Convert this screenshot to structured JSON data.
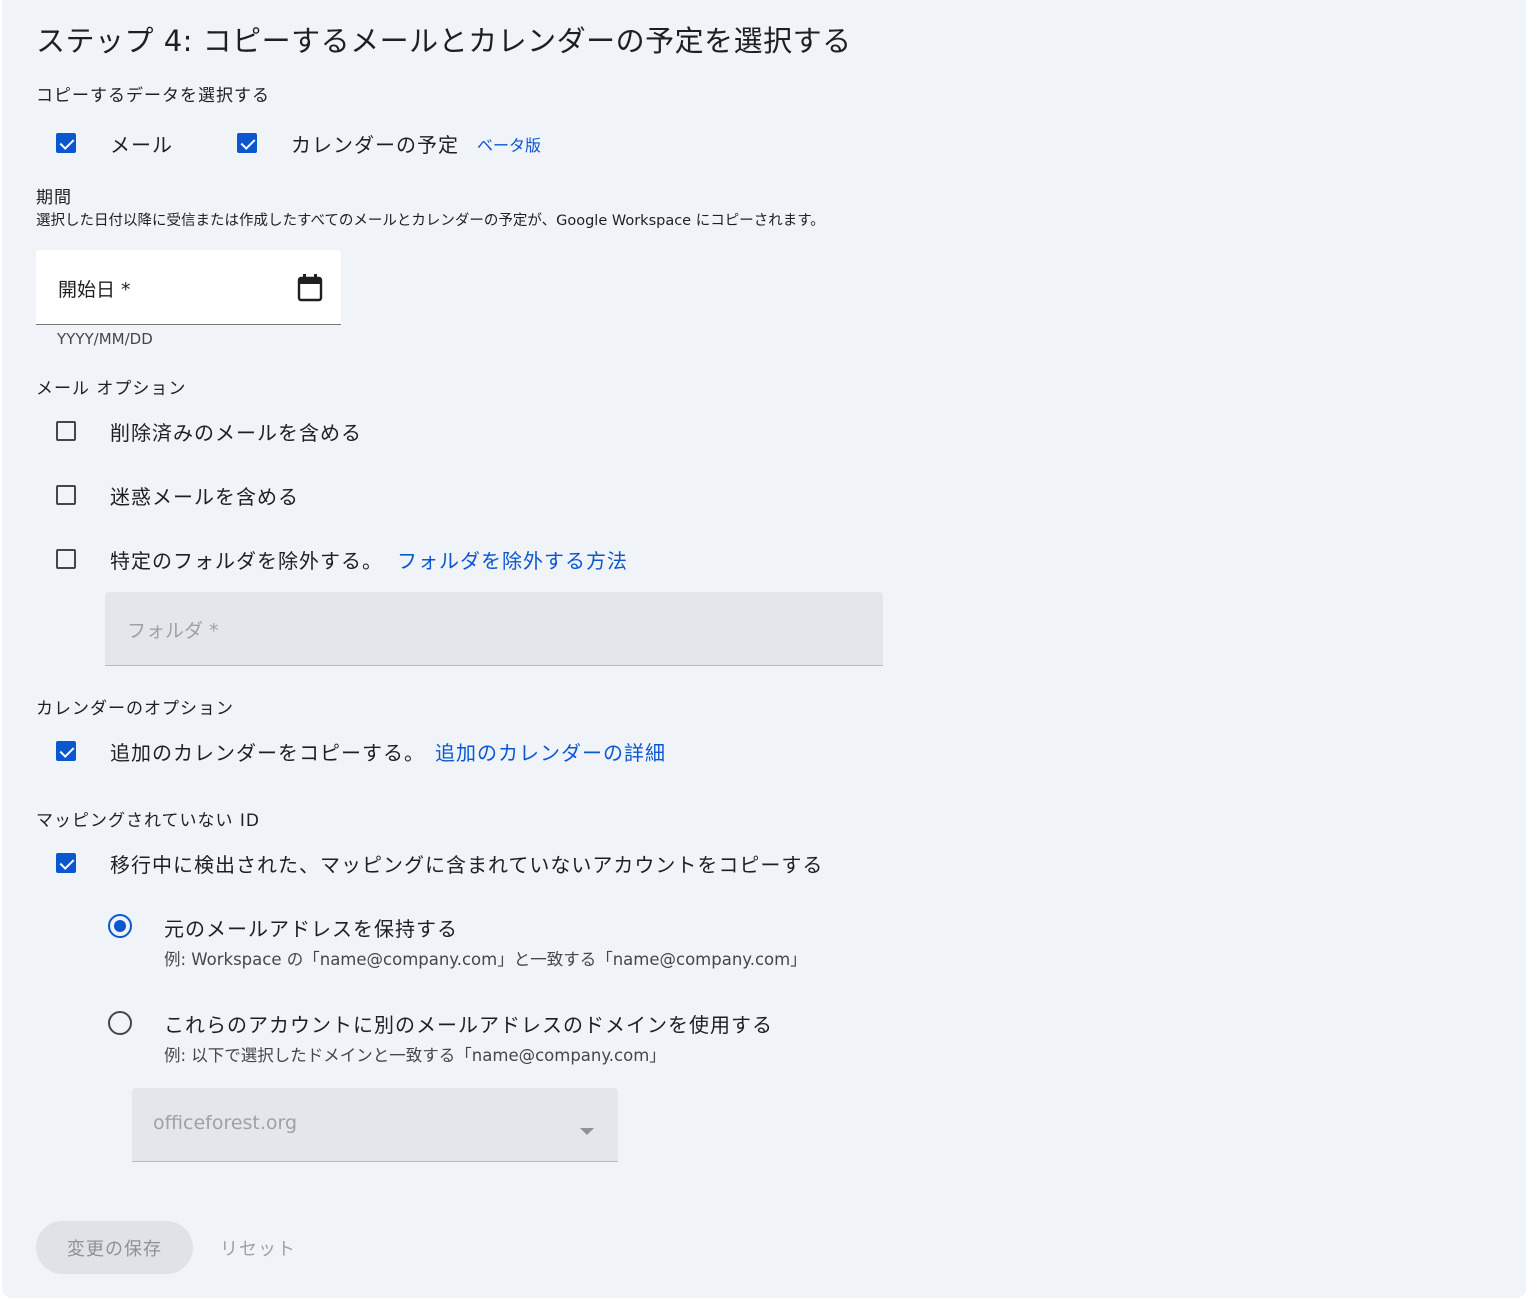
{
  "title": "ステップ 4: コピーするメールとカレンダーの予定を選択する",
  "data_selection": {
    "heading": "コピーするデータを選択する",
    "mail_label": "メール",
    "mail_checked": true,
    "calendar_label": "カレンダーの予定",
    "calendar_checked": true,
    "beta_label": "ベータ版"
  },
  "period": {
    "heading": "期間",
    "description": "選択した日付以降に受信または作成したすべてのメールとカレンダーの予定が、Google Workspace にコピーされます。",
    "start_date_label": "開始日 *",
    "start_date_hint": "YYYY/MM/DD",
    "icon": "calendar-icon"
  },
  "mail_options": {
    "heading": "メール オプション",
    "include_deleted": {
      "label": "削除済みのメールを含める",
      "checked": false
    },
    "include_spam": {
      "label": "迷惑メールを含める",
      "checked": false
    },
    "exclude_folders": {
      "label": "特定のフォルダを除外する。",
      "link": "フォルダを除外する方法",
      "checked": false
    },
    "folder_placeholder": "フォルダ *"
  },
  "calendar_options": {
    "heading": "カレンダーのオプション",
    "copy_additional": {
      "label": "追加のカレンダーをコピーする。",
      "link": "追加のカレンダーの詳細",
      "checked": true
    }
  },
  "unmapped": {
    "heading": "マッピングされていない ID",
    "copy_unmapped": {
      "label": "移行中に検出された、マッピングに含まれていないアカウントをコピーする",
      "checked": true
    },
    "option_keep": {
      "label": "元のメールアドレスを保持する",
      "example": "例: Workspace の「name@company.com」と一致する「name@company.com」",
      "selected": true
    },
    "option_domain": {
      "label": "これらのアカウントに別のメールアドレスのドメインを使用する",
      "example": "例: 以下で選択したドメインと一致する「name@company.com」",
      "selected": false
    },
    "domain_value": "officeforest.org"
  },
  "actions": {
    "save_label": "変更の保存",
    "reset_label": "リセット"
  },
  "colors": {
    "accent": "#0b57d0",
    "background": "#f0f4f9"
  }
}
